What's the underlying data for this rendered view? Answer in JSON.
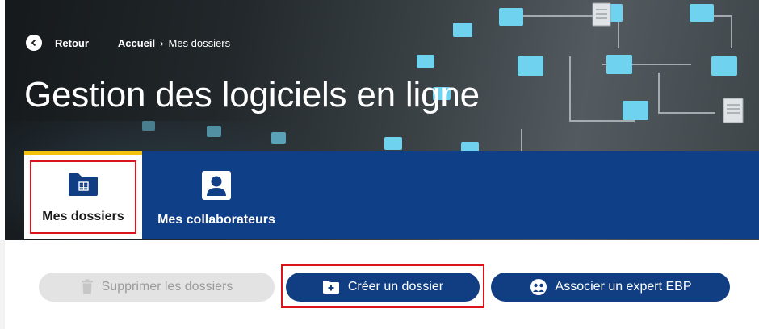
{
  "breadcrumb": {
    "back_label": "Retour",
    "home": "Accueil",
    "separator": "›",
    "current": "Mes dossiers"
  },
  "page_title": "Gestion des logiciels en ligne",
  "tabs": [
    {
      "label": "Mes dossiers",
      "icon": "folder-icon",
      "active": true
    },
    {
      "label": "Mes collaborateurs",
      "icon": "user-icon",
      "active": false
    }
  ],
  "actions": {
    "delete_label": "Supprimer les dossiers",
    "create_label": "Créer un dossier",
    "expert_label": "Associer un expert EBP"
  },
  "colors": {
    "primary": "#113e82",
    "accent": "#f4c20d",
    "highlight": "#d9141b",
    "disabled_bg": "#e3e3e3"
  }
}
